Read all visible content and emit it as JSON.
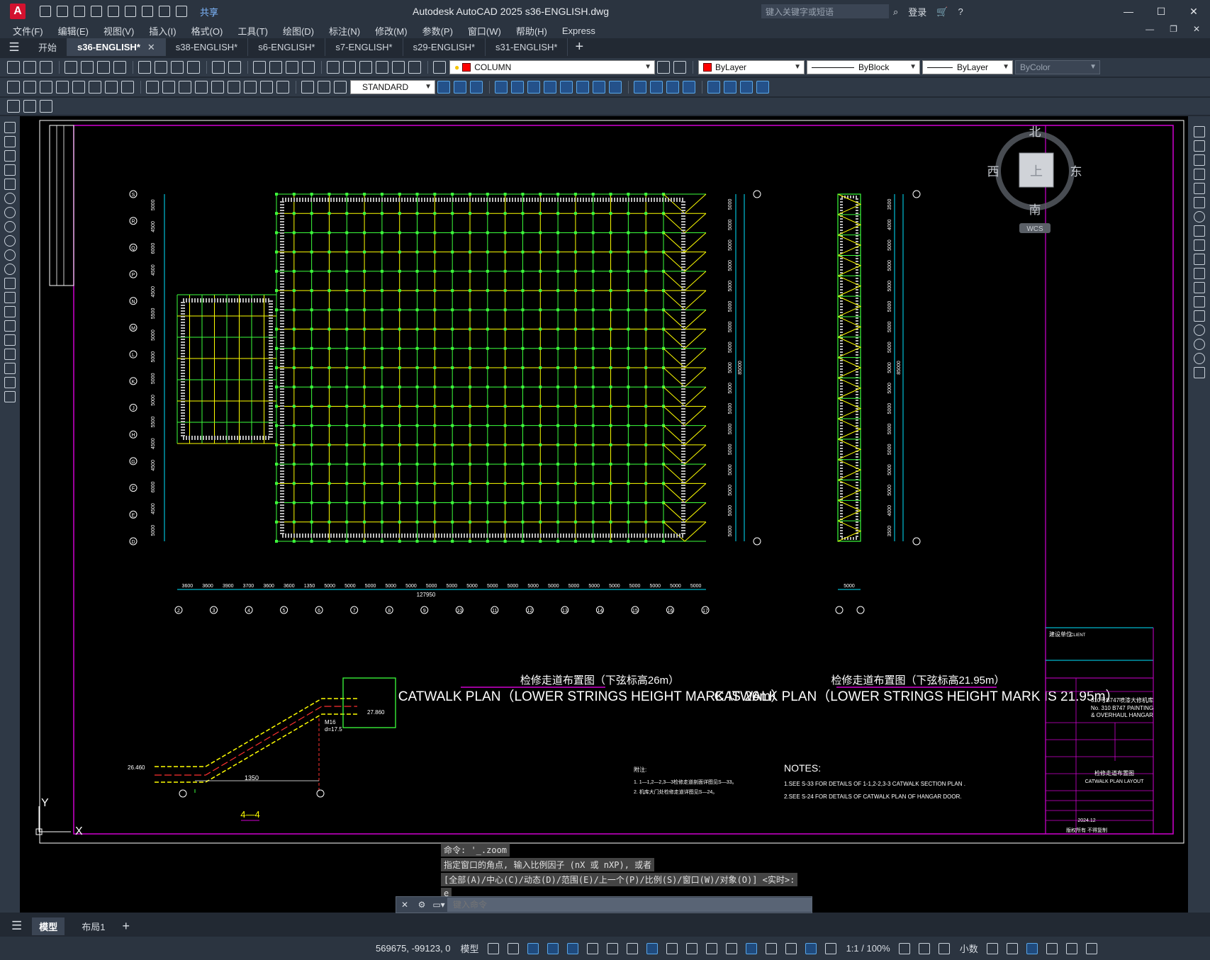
{
  "app": {
    "title": "Autodesk AutoCAD 2025    s36-ENGLISH.dwg",
    "share_label": "共享",
    "search_placeholder": "键入关键字或短语",
    "login_label": "登录"
  },
  "menu": [
    "文件(F)",
    "编辑(E)",
    "视图(V)",
    "插入(I)",
    "格式(O)",
    "工具(T)",
    "绘图(D)",
    "标注(N)",
    "修改(M)",
    "参数(P)",
    "窗口(W)",
    "帮助(H)",
    "Express"
  ],
  "tabs": [
    {
      "label": "开始",
      "active": false
    },
    {
      "label": "s36-ENGLISH*",
      "active": true
    },
    {
      "label": "s38-ENGLISH*",
      "active": false
    },
    {
      "label": "s6-ENGLISH*",
      "active": false
    },
    {
      "label": "s7-ENGLISH*",
      "active": false
    },
    {
      "label": "s29-ENGLISH*",
      "active": false
    },
    {
      "label": "s31-ENGLISH*",
      "active": false
    }
  ],
  "properties": {
    "layer": "COLUMN",
    "color": "ByLayer",
    "linetype": "ByBlock",
    "lineweight": "ByLayer",
    "plotstyle": "ByColor",
    "textstyle": "STANDARD"
  },
  "viewcube": {
    "north": "北",
    "south": "南",
    "east": "东",
    "west": "西",
    "top": "上",
    "wcs": "WCS"
  },
  "drawing": {
    "plan1_cn": "检修走道布置图（下弦标高26m）",
    "plan1_en": "CATWALK PLAN（LOWER STRINGS HEIGHT MARK IS 26m）",
    "plan2_cn": "检修走道布置图（下弦标高21.95m）",
    "plan2_en": "CATWALK PLAN（LOWER STRINGS HEIGHT MARK IS 21.95m）",
    "section_label": "4—4",
    "notes_title": "NOTES:",
    "note1": "1.SEE S-33 FOR DETAILS OF 1-1,2-2,3-3 CATWALK SECTION PLAN .",
    "note2": "2.SEE S-24 FOR DETAILS OF CATWALK PLAN OF HANGAR DOOR.",
    "cn_notes_title": "附注:",
    "cn_note1": "1. 1—1,2—2,3—3检修走道剖面详图见S—33。",
    "cn_note2": "2. 机库大门处检修走道详图见S—24。",
    "total_dim": "127950",
    "dim_5000": "5000",
    "dim_85000": "85000",
    "sec_dim1": "1350",
    "sec_elev1": "26.460",
    "sec_elev2": "27.860",
    "sec_m16": "M16",
    "sec_d": "d=17.5",
    "client_label": "建设单位",
    "client_en": "CLIENT",
    "project_cn": "310号B747喷漆大修机库",
    "project_en1": "No. 310 B747 PAINTING",
    "project_en2": "& OVERHAUL HANGAR",
    "dwg_title_cn": "检修走道布置图",
    "dwg_title_en": "CATWALK PLAN LAYOUT",
    "date": "2024.12",
    "copyright": "版权所有 不得复制"
  },
  "commands": {
    "history1": "命令: '_.zoom",
    "history2": "指定窗口的角点, 输入比例因子 (nX 或 nXP), 或者",
    "history3": "[全部(A)/中心(C)/动态(D)/范围(E)/上一个(P)/比例(S)/窗口(W)/对象(O)] <实时>:",
    "history4": "e",
    "input_placeholder": "键入命令"
  },
  "layout_tabs": [
    "模型",
    "布局1"
  ],
  "status": {
    "coords": "569675, -99123, 0",
    "mode": "模型",
    "scale": "1:1 / 100%",
    "units": "小数"
  },
  "colors": {
    "bg": "#000000",
    "grid_green": "#3cff3c",
    "grid_yellow": "#ffff00",
    "dim_cyan": "#00e5ff",
    "frame_magenta": "#d000d0"
  },
  "axis_left": [
    "S",
    "R",
    "Q",
    "P",
    "N",
    "M",
    "L",
    "K",
    "J",
    "H",
    "G",
    "F",
    "E",
    "D"
  ],
  "axis_bottom": [
    "2",
    "3",
    "4",
    "5",
    "6",
    "7",
    "8",
    "9",
    "10",
    "11",
    "12",
    "13",
    "14",
    "15",
    "16",
    "17"
  ],
  "dims_left": [
    "5000",
    "4500",
    "6000",
    "4500",
    "4500",
    "5500",
    "5000",
    "5000",
    "5000",
    "5000",
    "5500",
    "4500",
    "4500",
    "6000",
    "4500",
    "5000"
  ],
  "dims_bottom": [
    "3600",
    "3600",
    "3900",
    "3700",
    "3600",
    "3600",
    "1350",
    "5000",
    "5000",
    "5000",
    "5000",
    "5000",
    "5000",
    "5000",
    "5000",
    "5000",
    "5000",
    "5000",
    "5000",
    "5000",
    "5000",
    "5000",
    "5000",
    "5000",
    "5000",
    "5000"
  ],
  "dims_right2": [
    "3500",
    "4000",
    "5000",
    "5000",
    "5000",
    "5000",
    "5000",
    "5000",
    "5000",
    "5000",
    "5000",
    "5000",
    "5000",
    "5000",
    "5000",
    "4000",
    "3500"
  ]
}
